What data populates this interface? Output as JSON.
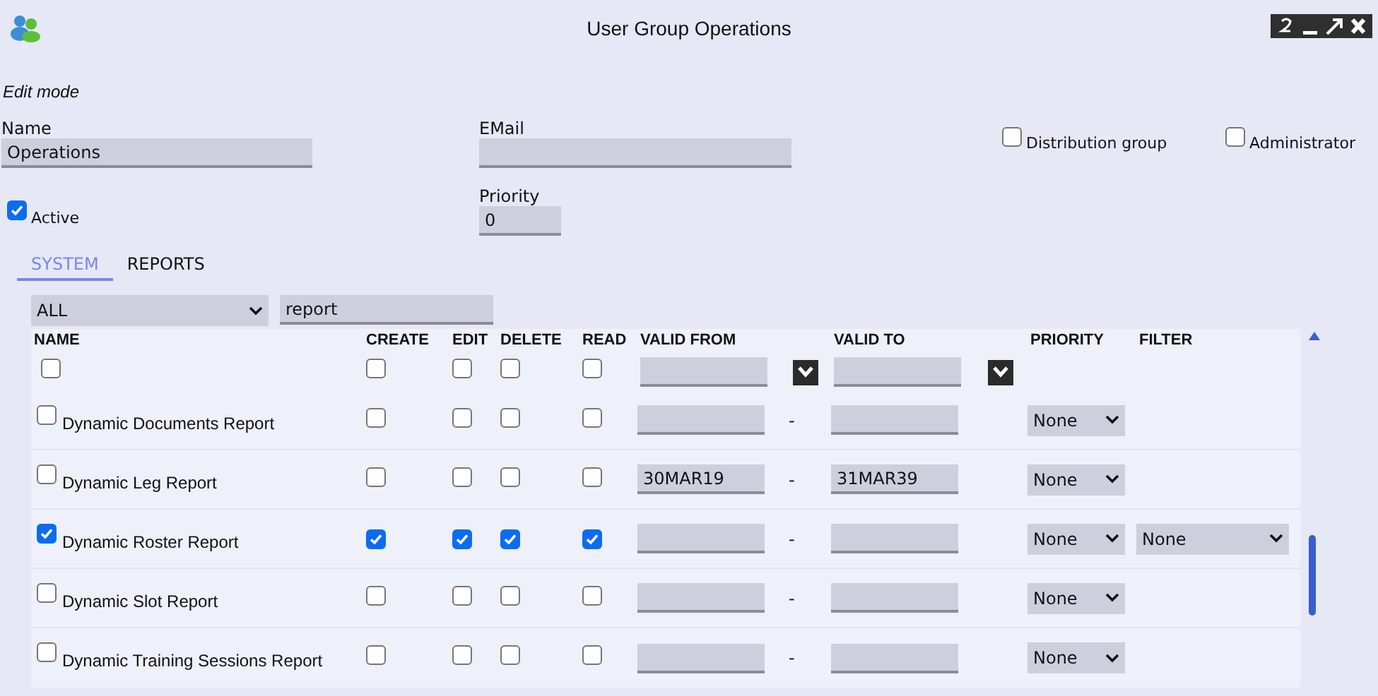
{
  "window": {
    "title": "User Group Operations"
  },
  "mode_label": "Edit mode",
  "fields": {
    "name": {
      "label": "Name",
      "value": "Operations"
    },
    "email": {
      "label": "EMail"
    },
    "priority": {
      "label": "Priority",
      "value": "0"
    }
  },
  "options": [
    {
      "label": "Distribution group",
      "checked": false
    },
    {
      "label": "Administrator",
      "checked": false
    }
  ],
  "active": {
    "label": "Active",
    "checked": true
  },
  "tabs": [
    {
      "label": "SYSTEM",
      "selected": true
    },
    {
      "label": "REPORTS",
      "selected": false
    }
  ],
  "filter": {
    "category": "ALL",
    "search": "report"
  },
  "table": {
    "columns": [
      "NAME",
      "CREATE",
      "EDIT",
      "DELETE",
      "READ",
      "VALID FROM",
      "VALID TO",
      "PRIORITY",
      "FILTER"
    ],
    "filter_row": {
      "checked": false,
      "create": false,
      "edit": false,
      "delete": false,
      "read": false
    },
    "rows": [
      {
        "name": "Dynamic Documents Report",
        "checked": false,
        "create": false,
        "edit": false,
        "delete": false,
        "read": false,
        "separator": "-",
        "priority": "None"
      },
      {
        "name": "Dynamic Leg Report",
        "checked": false,
        "create": false,
        "edit": false,
        "delete": false,
        "read": false,
        "valid_from": "30MAR19",
        "separator": "-",
        "valid_to": "31MAR39",
        "priority": "None"
      },
      {
        "name": "Dynamic Roster Report",
        "checked": true,
        "create": true,
        "edit": true,
        "delete": true,
        "read": true,
        "separator": "-",
        "priority": "None",
        "filter": "None"
      },
      {
        "name": "Dynamic Slot Report",
        "checked": false,
        "create": false,
        "edit": false,
        "delete": false,
        "read": false,
        "separator": "-",
        "priority": "None"
      },
      {
        "name": "Dynamic Training Sessions Report",
        "checked": false,
        "create": false,
        "edit": false,
        "delete": false,
        "read": false,
        "separator": "-",
        "priority": "None"
      }
    ]
  }
}
